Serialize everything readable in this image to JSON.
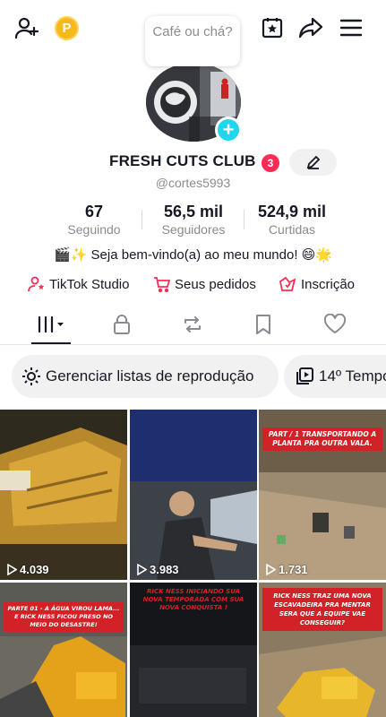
{
  "header": {
    "coin_letter": "P",
    "bubble_text": "Café ou chá?"
  },
  "profile": {
    "name": "FRESH CUTS CLUB",
    "badge_count": "3",
    "handle": "@cortes5993",
    "stats": [
      {
        "value": "67",
        "label": "Seguindo"
      },
      {
        "value": "56,5 mil",
        "label": "Seguidores"
      },
      {
        "value": "524,9 mil",
        "label": "Curtidas"
      }
    ],
    "bio": "🎬✨ Seja bem-vindo(a) ao meu mundo! 😄🌟"
  },
  "links": {
    "studio": "TikTok Studio",
    "orders": "Seus pedidos",
    "subscription": "Inscrição"
  },
  "chips": {
    "playlists": "Gerenciar listas de reprodução",
    "season": "14º Tempo"
  },
  "videos": [
    {
      "views": "4.039",
      "banner": ""
    },
    {
      "views": "3.983",
      "banner": ""
    },
    {
      "views": "1.731",
      "banner": "PART / 1 TRANSPORTANDO A PLANTA PRA OUTRA VALA."
    },
    {
      "views": "",
      "banner": "PARTE 01 - A ÁGUA VIROU LAMA... E RICK NESS FICOU PRESO NO MEIO DO DESASTRE!"
    },
    {
      "views": "",
      "banner": "RICK NESS INICIANDO SUA NOVA TEMPORADA COM SUA NOVA CONQUISTA !"
    },
    {
      "views": "",
      "banner": "Rick ness traz uma nova escavadeira pra mentar Sera que a equipe vae conseguir?"
    }
  ],
  "colors": {
    "accent": "#fe2c55",
    "plus": "#20d5ec",
    "coin": "#f6b81c"
  }
}
